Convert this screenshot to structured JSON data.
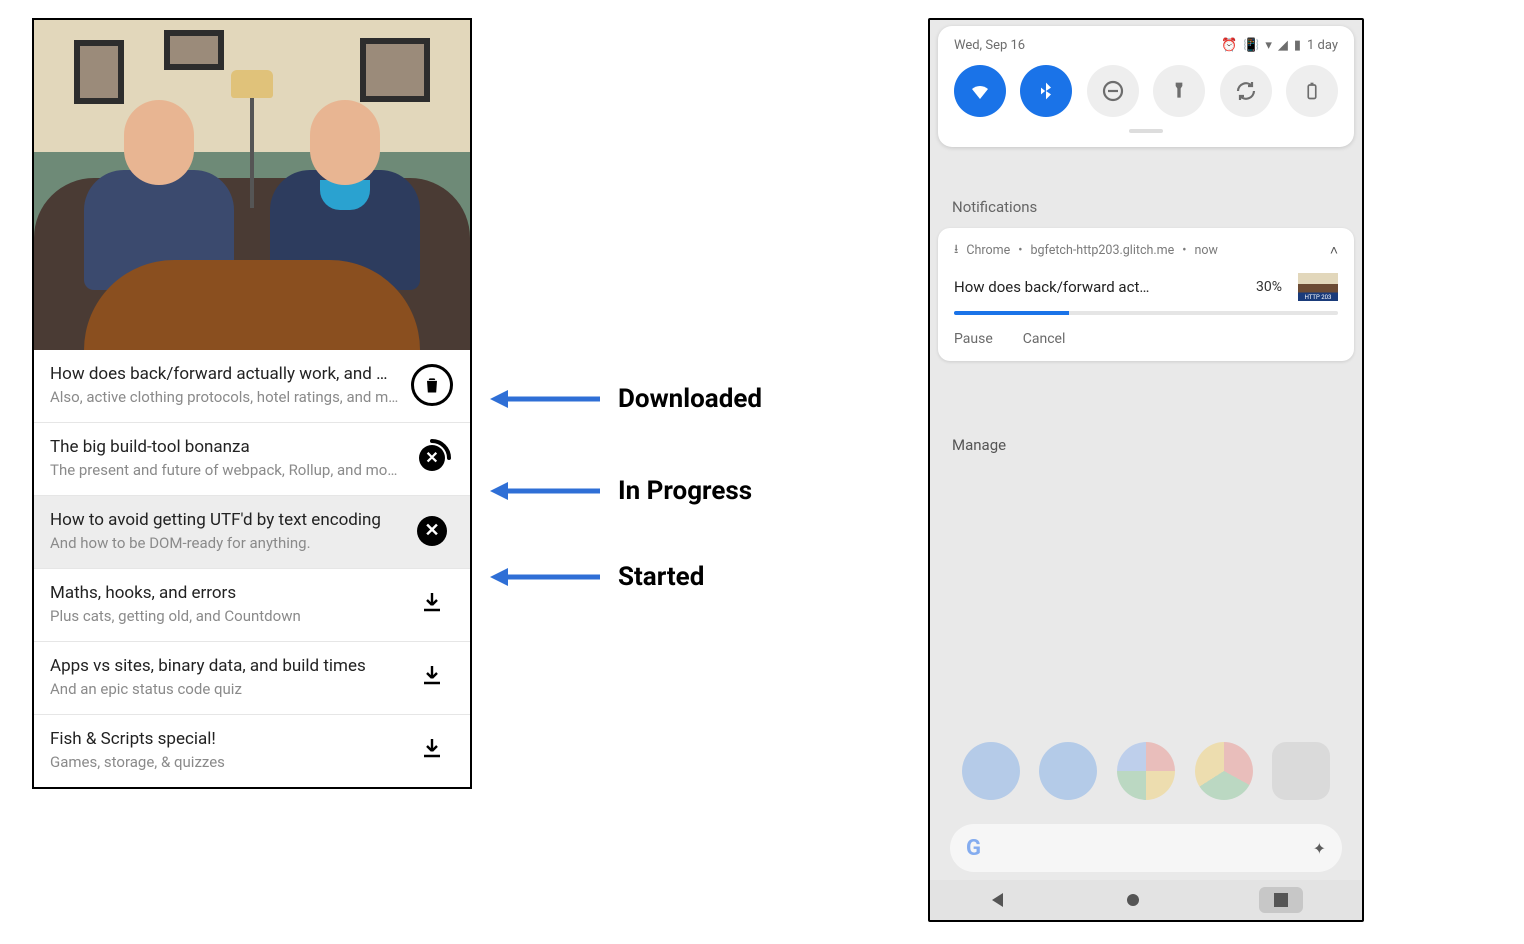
{
  "annotations": {
    "downloaded": "Downloaded",
    "in_progress": "In Progress",
    "started": "Started"
  },
  "episodes": [
    {
      "title": "How does back/forward actually work, and much more!",
      "subtitle": "Also, active clothing protocols, hotel ratings, and more.",
      "state": "downloaded",
      "selected": false
    },
    {
      "title": "The big build-tool bonanza",
      "subtitle": "The present and future of webpack, Rollup, and more.",
      "state": "in_progress",
      "selected": false
    },
    {
      "title": "How to avoid getting UTF'd by text encoding",
      "subtitle": "And how to be DOM-ready for anything.",
      "state": "started",
      "selected": true
    },
    {
      "title": "Maths, hooks, and errors",
      "subtitle": "Plus cats, getting old, and Countdown",
      "state": "idle",
      "selected": false
    },
    {
      "title": "Apps vs sites, binary data, and build times",
      "subtitle": "And an epic status code quiz",
      "state": "idle",
      "selected": false
    },
    {
      "title": "Fish & Scripts special!",
      "subtitle": "Games, storage, & quizzes",
      "state": "idle",
      "selected": false
    }
  ],
  "phone": {
    "status": {
      "date": "Wed, Sep 16",
      "battery_label": "1 day"
    },
    "quick_settings": [
      {
        "name": "wifi",
        "on": true
      },
      {
        "name": "bluetooth",
        "on": true
      },
      {
        "name": "dnd",
        "on": false
      },
      {
        "name": "flashlight",
        "on": false
      },
      {
        "name": "rotation",
        "on": false
      },
      {
        "name": "battery-saver",
        "on": false
      }
    ],
    "notifications_header": "Notifications",
    "notification": {
      "app": "Chrome",
      "source": "bgfetch-http203.glitch.me",
      "time": "now",
      "title": "How does back/forward act…",
      "percent_label": "30%",
      "percent": 30,
      "actions": {
        "pause": "Pause",
        "cancel": "Cancel"
      }
    },
    "manage_label": "Manage"
  }
}
